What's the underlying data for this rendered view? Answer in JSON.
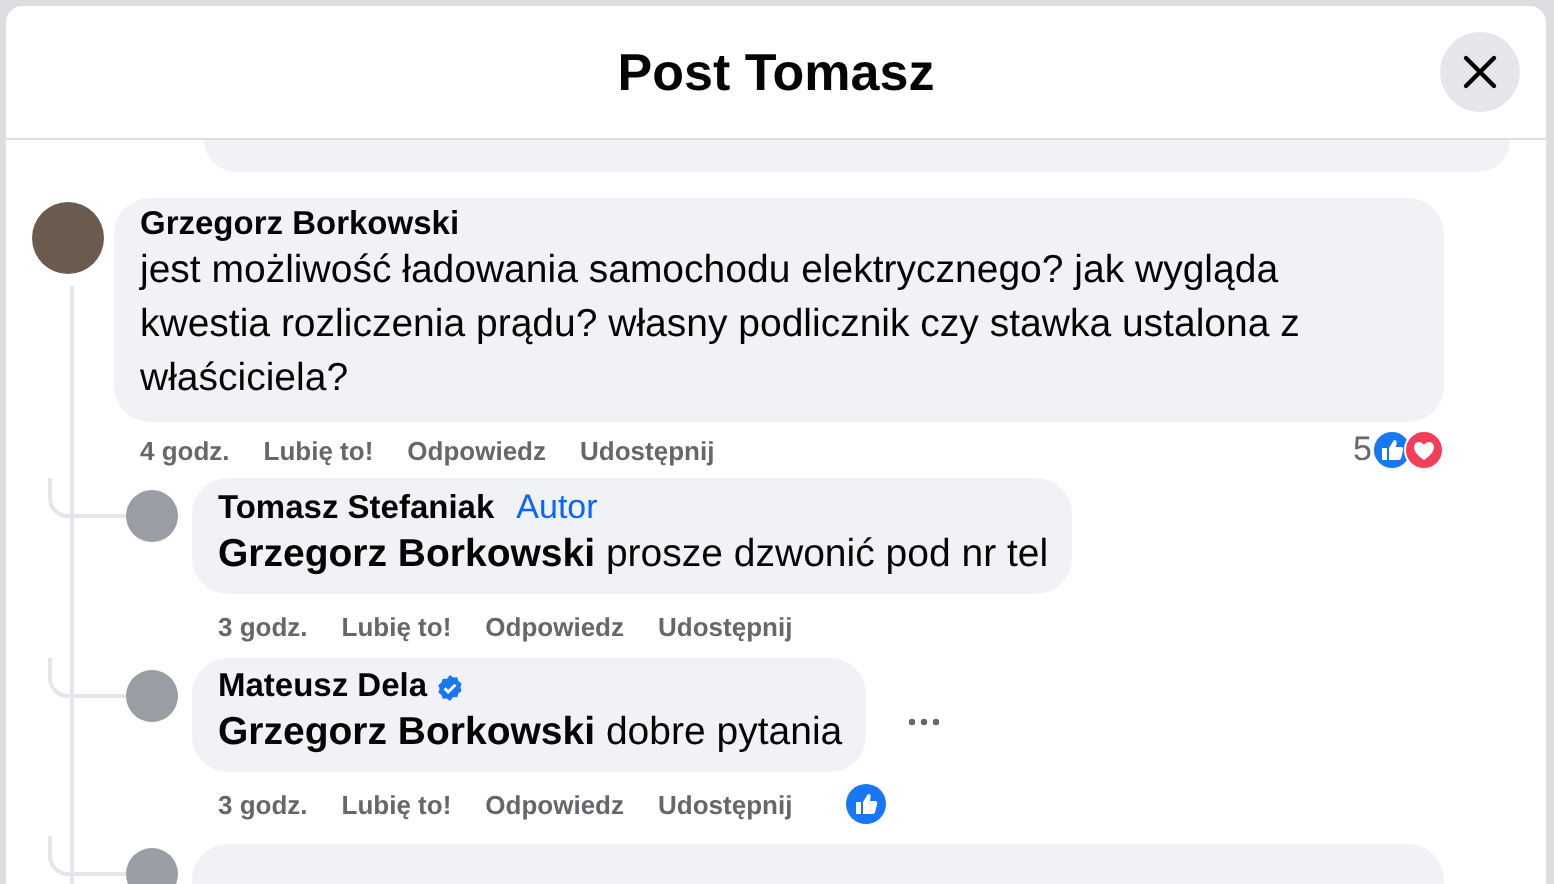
{
  "dialog": {
    "title": "Post Tomasz"
  },
  "comment": {
    "author": "Grzegorz Borkowski",
    "text": "jest możliwość ładowania samochodu elektrycznego? jak wygląda kwestia rozliczenia prądu? własny podlicznik czy stawka ustalona z właściciela?",
    "time": "4 godz.",
    "actions": [
      "Lubię to!",
      "Odpowiedz",
      "Udostępnij"
    ],
    "reaction_count": "5",
    "reactions": [
      {
        "kind": "like"
      },
      {
        "kind": "love"
      }
    ],
    "replies": [
      {
        "author": "Tomasz Stefaniak",
        "badge": "Autor",
        "verified": false,
        "mention": "Grzegorz Borkowski",
        "text": "prosze dzwonić pod nr tel",
        "time": "3 godz.",
        "actions": [
          "Lubię to!",
          "Odpowiedz",
          "Udostępnij"
        ],
        "more_menu": false
      },
      {
        "author": "Mateusz Dela",
        "verified": true,
        "mention": "Grzegorz Borkowski",
        "text": "dobre pytania",
        "time": "3 godz.",
        "actions": [
          "Lubię to!",
          "Odpowiedz",
          "Udostępnij"
        ],
        "reactions": [
          {
            "kind": "like"
          }
        ],
        "more_menu": true
      }
    ]
  }
}
